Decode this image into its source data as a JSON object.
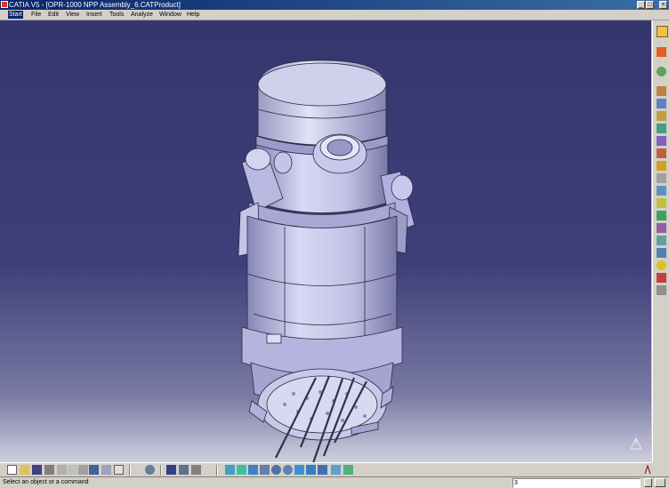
{
  "window": {
    "title": "CATIA V5 - [OPR-1000 NPP Assembly_6.CATProduct]",
    "controls": {
      "minimize": "_",
      "maximize": "□",
      "close": "×"
    }
  },
  "menubar": {
    "items": [
      {
        "label": "Start",
        "active": true
      },
      {
        "label": "File"
      },
      {
        "label": "Edit"
      },
      {
        "label": "View"
      },
      {
        "label": "Insert"
      },
      {
        "label": "Tools"
      },
      {
        "label": "Analyze"
      },
      {
        "label": "Window"
      },
      {
        "label": "Help"
      }
    ]
  },
  "viewport": {
    "model": "reactor-vessel-assembly",
    "background_top": "#36366e",
    "background_bottom": "#cfcfe0",
    "model_color": "#c8c8e8"
  },
  "right_toolbar": {
    "icons": [
      "pointer-icon",
      "sketcher-icon",
      "product-icon",
      "component-icon",
      "part-icon",
      "existing-component-icon",
      "replace-icon",
      "graph-tree-icon",
      "generate-numbering-icon",
      "manipulation-icon",
      "snap-icon",
      "explode-icon",
      "clash-icon",
      "constraint-icon",
      "fix-icon",
      "coincidence-icon",
      "contact-icon",
      "offset-icon",
      "angle-icon",
      "update-icon"
    ]
  },
  "bottom_toolbar": {
    "icons": [
      "new-icon",
      "open-icon",
      "save-icon",
      "print-icon",
      "cut-icon",
      "copy-icon",
      "paste-icon",
      "undo-icon",
      "redo-icon",
      "whats-this-icon",
      "formula-icon",
      "catalog-icon",
      "render-icon",
      "measure-icon",
      "fly-icon",
      "fit-all-icon",
      "pan-icon",
      "rotate-icon",
      "zoom-in-icon",
      "zoom-out-icon",
      "normal-view-icon",
      "iso-view-icon",
      "shading-icon",
      "hide-show-icon",
      "swap-visible-icon",
      "view-mode-icon"
    ]
  },
  "statusbar": {
    "message": "Select an object or a command",
    "command_value": "3"
  },
  "colors": {
    "titlebar": "#0a246a",
    "chrome": "#d4d0c8"
  }
}
